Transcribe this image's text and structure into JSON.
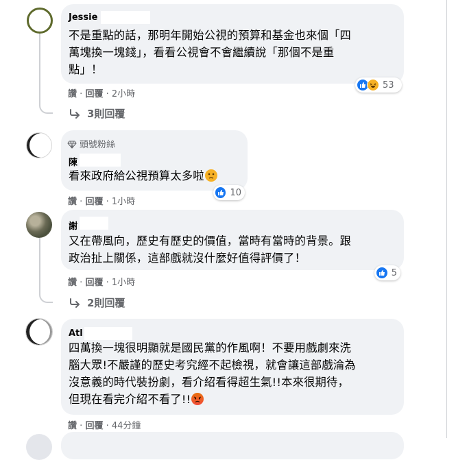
{
  "comments": [
    {
      "author": "Jessie",
      "lines": [
        "不是重點的話，那明年開始公視的預算和基金也來個「四",
        "萬塊換一塊錢」，看看公視會不會繼續說「那個不是重",
        "點」！"
      ],
      "actions": {
        "like": "讚",
        "reply": "回覆",
        "time": "2小時"
      },
      "reactions": {
        "count": "53",
        "types": [
          "like-icon",
          "haha-icon"
        ]
      },
      "replies_link": "3則回覆"
    },
    {
      "badge": "頭號粉絲",
      "author": "陳",
      "lines": [
        "看來政府給公視預算太多啦"
      ],
      "emoji": "confused-face-emoji",
      "actions": {
        "like": "讚",
        "reply": "回覆",
        "time": "1小時"
      },
      "reactions": {
        "count": "10",
        "types": [
          "like-icon"
        ]
      }
    },
    {
      "author": "謝",
      "lines": [
        "又在帶風向，歷史有歷史的價值，當時有當時的背景。跟",
        "政治扯上關係，這部戲就沒什麼好值得評價了！"
      ],
      "actions": {
        "like": "讚",
        "reply": "回覆",
        "time": "1小時"
      },
      "reactions": {
        "count": "5",
        "types": [
          "like-icon"
        ]
      },
      "replies_link": "2則回覆"
    },
    {
      "author": "Atl",
      "lines": [
        "四萬換一塊很明顯就是國民黨的作風啊！不要用戲劇來洗",
        "腦大眾!不嚴謹的歷史考究經不起檢視，就會讓這部戲淪為",
        "沒意義的時代裝扮劇，看介紹看得超生氣!!本來很期待，",
        "但現在看完介紹不看了!!"
      ],
      "emoji": "angry-face-emoji",
      "actions": {
        "like": "讚",
        "reply": "回覆",
        "time": "44分鐘"
      }
    }
  ],
  "separator": "·"
}
